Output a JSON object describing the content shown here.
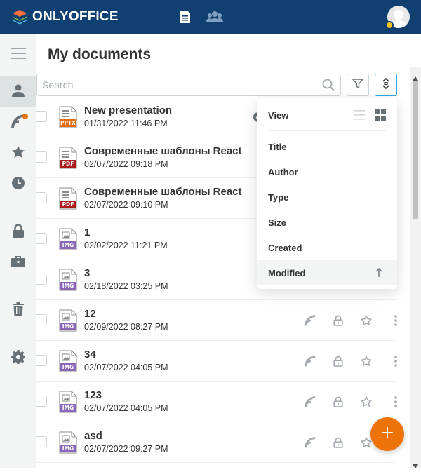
{
  "header": {
    "logo_text": "ONLYOFFICE",
    "brand_color": "#0f4071",
    "icons": [
      "documents-icon",
      "people-icon"
    ],
    "avatar_badge_color": "#f2c40d"
  },
  "sidebar": {
    "items": [
      {
        "name": "menu",
        "icon": "hamburger-icon"
      },
      {
        "name": "my-documents",
        "icon": "person-icon",
        "active": true
      },
      {
        "name": "shared",
        "icon": "rss-icon",
        "badge": true
      },
      {
        "name": "favorites",
        "icon": "star-icon"
      },
      {
        "name": "recent",
        "icon": "clock-icon"
      },
      {
        "name": "private",
        "icon": "lock-icon"
      },
      {
        "name": "common",
        "icon": "briefcase-icon"
      },
      {
        "name": "trash",
        "icon": "trash-icon"
      },
      {
        "name": "settings",
        "icon": "gear-icon"
      }
    ]
  },
  "main": {
    "title": "My documents",
    "search_placeholder": "Search"
  },
  "files": [
    {
      "name": "New presentation",
      "date": "01/31/2022 11:46 PM",
      "type": "PPTX"
    },
    {
      "name": "Современные шаблоны React",
      "date": "02/07/2022 09:18 PM",
      "type": "PDF"
    },
    {
      "name": "Современные шаблоны React",
      "date": "02/07/2022 09:10 PM",
      "type": "PDF"
    },
    {
      "name": "1",
      "date": "02/02/2022 11:21 PM",
      "type": "IMG"
    },
    {
      "name": "3",
      "date": "02/18/2022 03:25 PM",
      "type": "IMG"
    },
    {
      "name": "12",
      "date": "02/09/2022 08:27 PM",
      "type": "IMG"
    },
    {
      "name": "34",
      "date": "02/07/2022 04:05 PM",
      "type": "IMG"
    },
    {
      "name": "123",
      "date": "02/07/2022 04:05 PM",
      "type": "IMG"
    },
    {
      "name": "asd",
      "date": "02/07/2022 09:27 PM",
      "type": "IMG"
    }
  ],
  "sort_menu": {
    "view_label": "View",
    "options": [
      "Title",
      "Author",
      "Type",
      "Size",
      "Created",
      "Modified"
    ],
    "selected": "Modified"
  },
  "colors": {
    "accent": "#2da7db",
    "fab": "#ed7309",
    "notify": "#ed7309",
    "pdf": "#aa1b1b",
    "pptx": "#e26d0c",
    "img": "#8a67b8"
  }
}
